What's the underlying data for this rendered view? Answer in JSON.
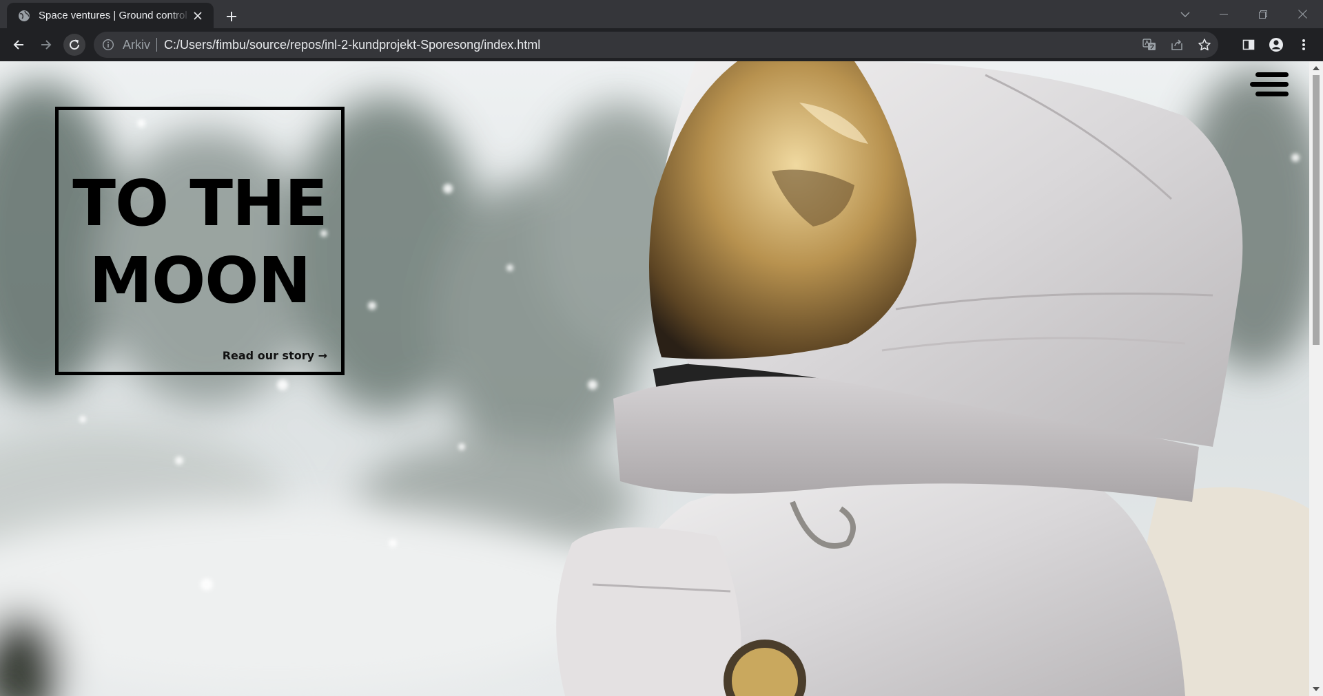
{
  "browser": {
    "tab_title": "Space ventures | Ground control",
    "omnibox_chip": "Arkiv",
    "url": "C:/Users/fimbu/source/repos/inl-2-kundprojekt-Sporesong/index.html"
  },
  "icons": {
    "favicon": "globe-icon",
    "close": "close-icon",
    "new_tab": "plus-icon",
    "back": "arrow-left-icon",
    "forward": "arrow-right-icon",
    "reload": "reload-icon",
    "site_info": "info-icon",
    "translate": "translate-icon",
    "share": "share-icon",
    "bookmark": "star-icon",
    "side_panel": "side-panel-icon",
    "profile": "profile-icon",
    "menu": "kebab-menu-icon",
    "site_menu": "hamburger-icon"
  },
  "page": {
    "hero_title_line1": "TO THE",
    "hero_title_line2": "MOON",
    "story_link": "Read our story →"
  },
  "colors": {
    "chrome_dark": "#202124",
    "tabstrip": "#35363a",
    "title_box_border": "#000000"
  }
}
